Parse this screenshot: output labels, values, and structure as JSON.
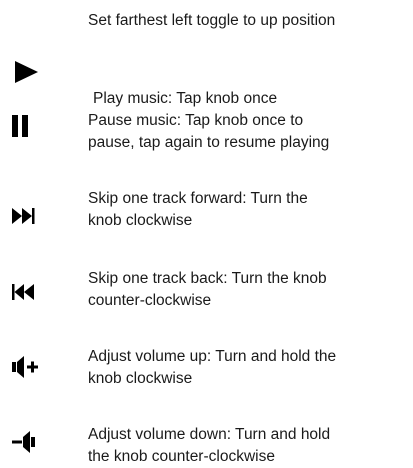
{
  "intro": {
    "text": "Set farthest left toggle to up position"
  },
  "instructions": [
    {
      "icon": "play-icon",
      "lines": [
        "Play music: Tap knob once"
      ]
    },
    {
      "icon": "pause-icon",
      "lines": [
        "Pause music: Tap knob once to",
        "pause, tap again to resume playing"
      ]
    },
    {
      "icon": "skip-forward-icon",
      "lines": [
        "Skip one track forward: Turn the",
        "knob clockwise"
      ]
    },
    {
      "icon": "skip-back-icon",
      "lines": [
        "Skip one track back: Turn the knob",
        "counter-clockwise"
      ]
    },
    {
      "icon": "volume-up-icon",
      "lines": [
        "Adjust volume up: Turn and hold the",
        "knob clockwise"
      ]
    },
    {
      "icon": "volume-down-icon",
      "lines": [
        "Adjust volume down: Turn and hold",
        "the knob counter-clockwise"
      ]
    }
  ],
  "colors": {
    "text": "#1a1a1a",
    "icon": "#000000",
    "background": "#ffffff"
  }
}
